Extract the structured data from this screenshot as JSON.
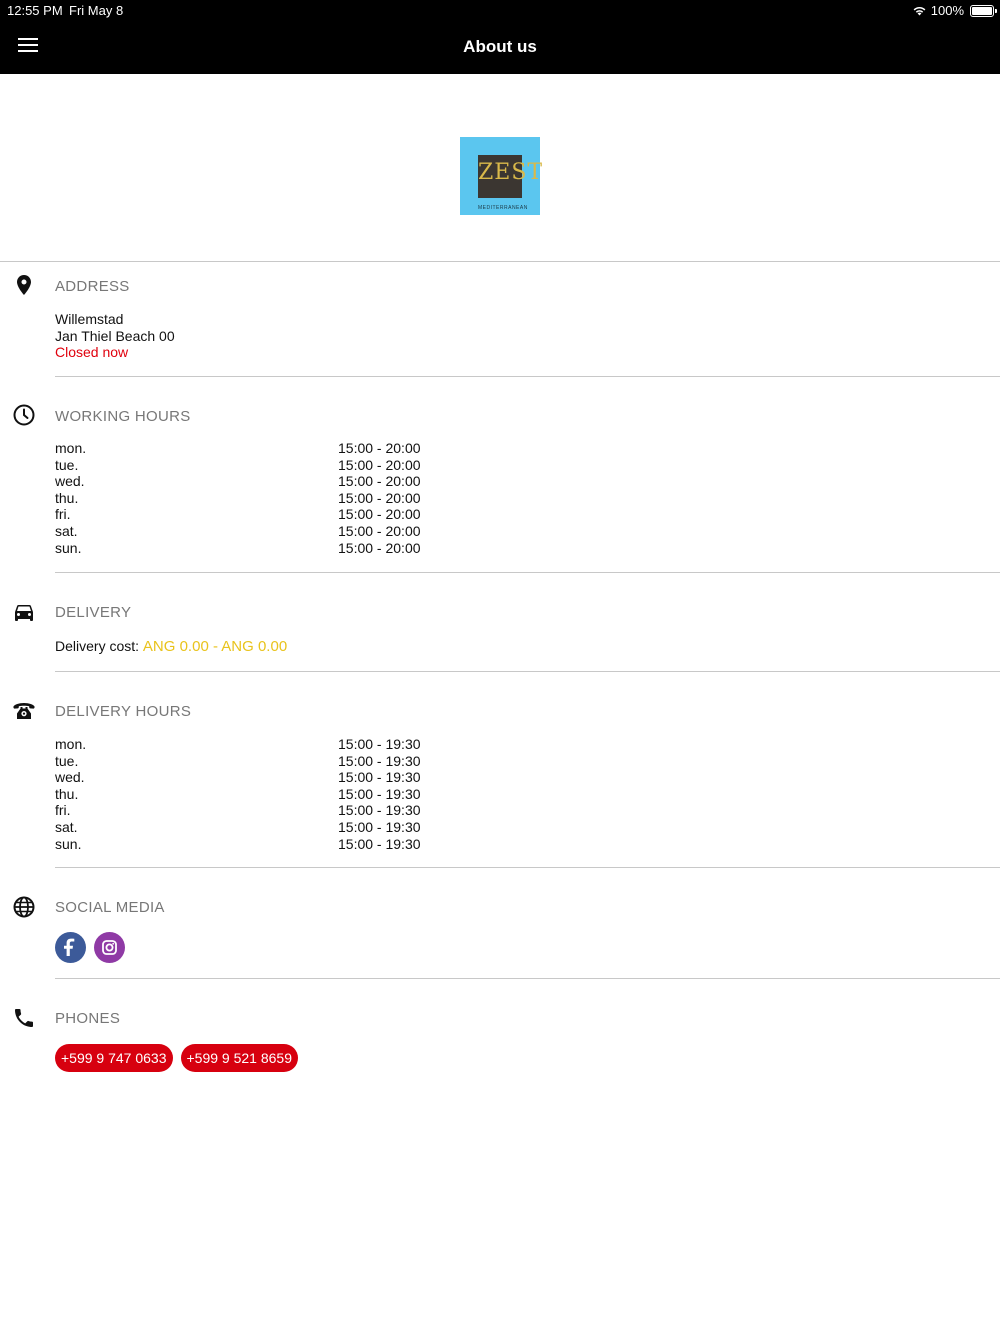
{
  "status_bar": {
    "time": "12:55 PM",
    "date": "Fri May 8",
    "battery": "100%"
  },
  "header": {
    "title": "About us"
  },
  "logo": {
    "word": "ZEST",
    "sub": "MEDITERRANEAN",
    "bg_color": "#5bc6ef"
  },
  "address": {
    "title": "ADDRESS",
    "line1": "Willemstad",
    "line2": "Jan Thiel Beach 00",
    "status": "Closed now",
    "status_color": "#e0000d"
  },
  "working_hours": {
    "title": "WORKING HOURS",
    "rows": [
      {
        "day": "mon.",
        "time": "15:00 - 20:00"
      },
      {
        "day": "tue.",
        "time": "15:00 - 20:00"
      },
      {
        "day": "wed.",
        "time": "15:00 - 20:00"
      },
      {
        "day": "thu.",
        "time": "15:00 - 20:00"
      },
      {
        "day": "fri.",
        "time": "15:00 - 20:00"
      },
      {
        "day": "sat.",
        "time": "15:00 - 20:00"
      },
      {
        "day": "sun.",
        "time": "15:00 - 20:00"
      }
    ]
  },
  "delivery": {
    "title": "DELIVERY",
    "cost_label": "Delivery cost:",
    "cost_value": "ANG 0.00 - ANG 0.00",
    "cost_color": "#e9c31c"
  },
  "delivery_hours": {
    "title": "DELIVERY HOURS",
    "rows": [
      {
        "day": "mon.",
        "time": "15:00 - 19:30"
      },
      {
        "day": "tue.",
        "time": "15:00 - 19:30"
      },
      {
        "day": "wed.",
        "time": "15:00 - 19:30"
      },
      {
        "day": "thu.",
        "time": "15:00 - 19:30"
      },
      {
        "day": "fri.",
        "time": "15:00 - 19:30"
      },
      {
        "day": "sat.",
        "time": "15:00 - 19:30"
      },
      {
        "day": "sun.",
        "time": "15:00 - 19:30"
      }
    ]
  },
  "social": {
    "title": "SOCIAL MEDIA",
    "items": [
      {
        "icon": "facebook-icon",
        "color": "#3c5a99"
      },
      {
        "icon": "instagram-icon",
        "color": "#8f3aa5"
      }
    ]
  },
  "phones": {
    "title": "PHONES",
    "items": [
      "+599 9 747 0633",
      "+599 9 521 8659"
    ],
    "button_color": "#d7000f"
  }
}
